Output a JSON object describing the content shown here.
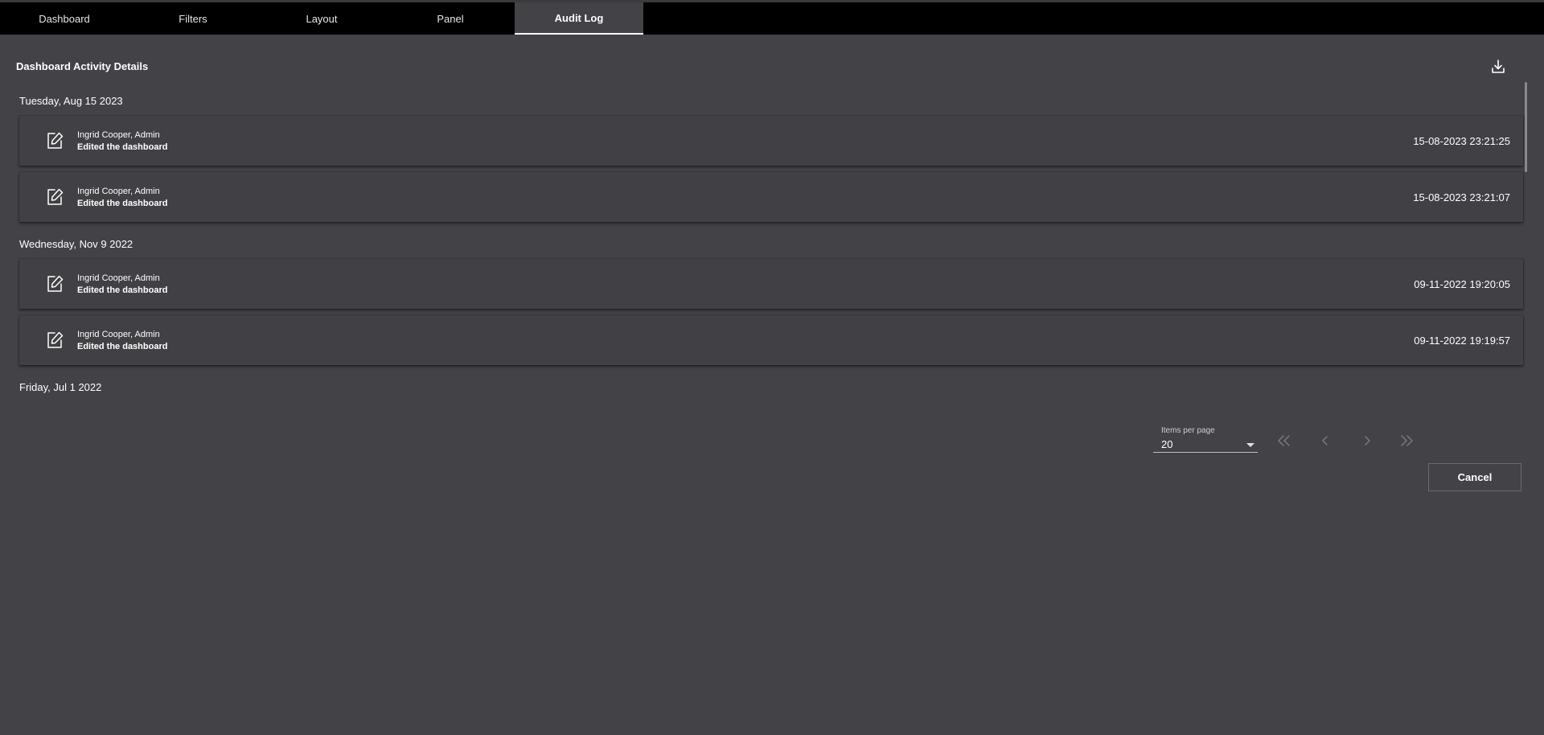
{
  "tabs": [
    {
      "label": "Dashboard"
    },
    {
      "label": "Filters"
    },
    {
      "label": "Layout"
    },
    {
      "label": "Panel"
    },
    {
      "label": "Audit Log",
      "active": true
    }
  ],
  "panel": {
    "title": "Dashboard Activity Details",
    "download_icon": "download-icon"
  },
  "groups": [
    {
      "date": "Tuesday, Aug 15 2023",
      "entries": [
        {
          "user": "Ingrid Cooper, Admin",
          "action": "Edited the dashboard",
          "timestamp": "15-08-2023 23:21:25",
          "icon": "edit-icon"
        },
        {
          "user": "Ingrid Cooper, Admin",
          "action": "Edited the dashboard",
          "timestamp": "15-08-2023 23:21:07",
          "icon": "edit-icon"
        }
      ]
    },
    {
      "date": "Wednesday, Nov 9 2022",
      "entries": [
        {
          "user": "Ingrid Cooper, Admin",
          "action": "Edited the dashboard",
          "timestamp": "09-11-2022 19:20:05",
          "icon": "edit-icon"
        },
        {
          "user": "Ingrid Cooper, Admin",
          "action": "Edited the dashboard",
          "timestamp": "09-11-2022 19:19:57",
          "icon": "edit-icon"
        }
      ]
    },
    {
      "date": "Friday, Jul 1 2022",
      "entries": []
    }
  ],
  "pagination": {
    "items_per_page_label": "Items per page",
    "items_per_page_value": "20",
    "first_icon": "first-page-icon",
    "prev_icon": "previous-page-icon",
    "next_icon": "next-page-icon",
    "last_icon": "last-page-icon"
  },
  "footer": {
    "cancel_label": "Cancel"
  },
  "colors": {
    "background": "#434246",
    "tabbar": "#000000",
    "text": "#ffffff"
  }
}
